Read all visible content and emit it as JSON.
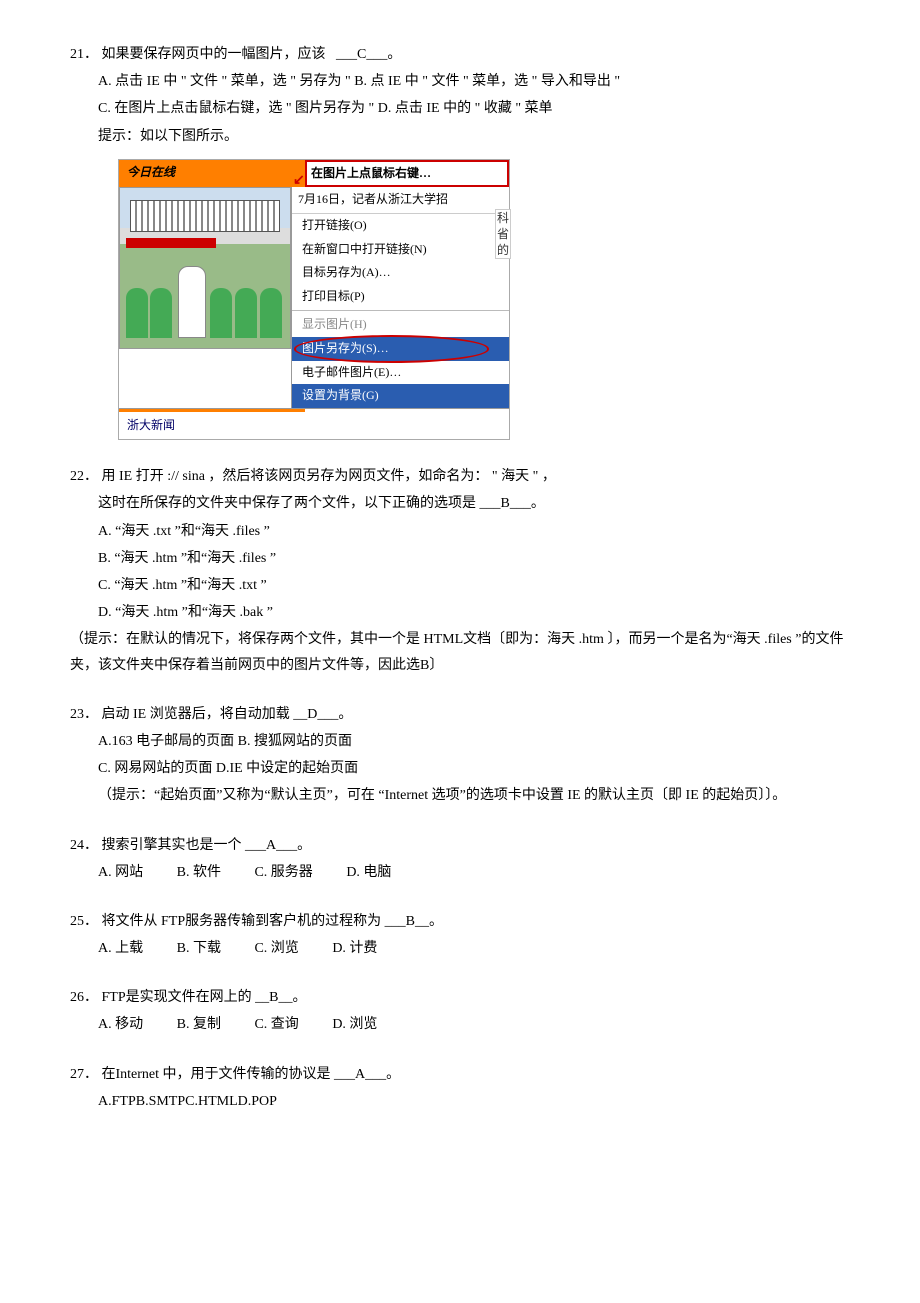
{
  "q21": {
    "num": "21．",
    "stem_a": "如果要保存网页中的一幅图片，应该",
    "blank": "___C___",
    "stem_b": "。",
    "optA": "A. 点击 IE 中 \" 文件 \" 菜单，选 \" 另存为 \"",
    "optB": "B. 点 IE 中 \" 文件 \" 菜单，选 \" 导入和导出 \"",
    "optC": "C. 在图片上点击鼠标右键，选  \" 图片另存为 \"",
    "optD": "D. 点击 IE 中的 \" 收藏 \" 菜单",
    "hint": "提示：如以下图所示。",
    "illus": {
      "top_left": "今日在线",
      "top_right": "在图片上点鼠标右键…",
      "caption": "7月16日，记者从浙江大学招",
      "menu": {
        "m1": "打开链接(O)",
        "m2": "在新窗口中打开链接(N)",
        "m3": "目标另存为(A)…",
        "m4": "打印目标(P)",
        "m5": "显示图片(H)",
        "m6": "图片另存为(S)…",
        "m7": "电子邮件图片(E)…",
        "m8": "设置为背景(G)"
      },
      "side": "科省的",
      "bottom_left": "浙大新闻"
    }
  },
  "q22": {
    "num": "22．",
    "stem_a": "用 IE 打开   :// sina            ，然后将该网页另存为网页文件，如命名为：    \" 海天 \" ，",
    "stem_b": "这时在所保存的文件夹中保存了两个文件，以下正确的选项是      ___B___。",
    "optA": "A. “海天 .txt  ”和“海天 .files  ”",
    "optB": "B. “海天 .htm ”和“海天 .files  ”",
    "optC": "C. “海天 .htm ”和“海天 .txt  ”",
    "optD": "D. “海天 .htm ”和“海天 .bak ”",
    "hint": "（提示：在默认的情况下，将保存两个文件，其中一个是    HTML文档〔即为：海天  .htm 〕，而另一个是名为“海天  .files  ”的文件夹，该文件夹中保存着当前网页中的图片文件等，因此选B〕"
  },
  "q23": {
    "num": "23．",
    "stem": "启动 IE 浏览器后，将自动加载  __D___。",
    "optAB": "A.163 电子邮局的页面  B. 搜狐网站的页面",
    "optCD": "C. 网易网站的页面  D.IE 中设定的起始页面",
    "hint": "（提示：“起始页面”又称为“默认主页”，可在    “Internet  选项”的选项卡中设置 IE 的默认主页〔即 IE 的起始页〕〕。"
  },
  "q24": {
    "num": "24．",
    "stem": "搜索引擎其实也是一个  ___A___。",
    "optA": "A. 网站",
    "optB": "B.    软件",
    "optC": "C.   服务器",
    "optD": "D.     电脑"
  },
  "q25": {
    "num": "25．",
    "stem": "将文件从 FTP服务器传输到客户机的过程称为  ___B__。",
    "optA": "A. 上载",
    "optB": "B.   下载",
    "optC": "C.    浏览",
    "optD": "D.     计费"
  },
  "q26": {
    "num": "26．",
    "stem": "FTP是实现文件在网上的  __B__。",
    "optA": "A.  移动",
    "optB": "B.      复制",
    "optC": "C.     查询",
    "optD": "D.     浏览"
  },
  "q27": {
    "num": "27．",
    "stem": "在Internet  中，用于文件传输的协议是  ___A___。",
    "opts": "A.FTPB.SMTPC.HTMLD.POP"
  }
}
